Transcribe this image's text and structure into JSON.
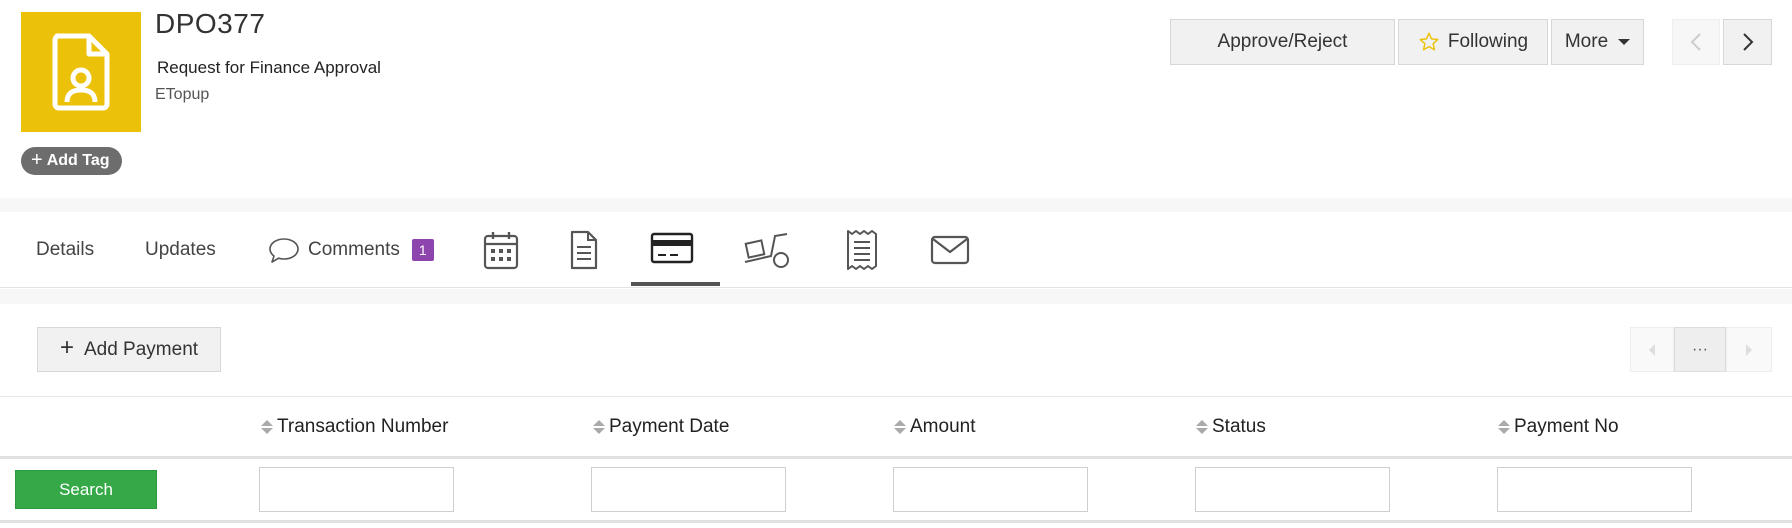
{
  "record": {
    "id": "DPO377",
    "title": "Request for Finance Approval",
    "subtitle": "ETopup",
    "avatar_icon": "document-user-icon",
    "avatar_color": "#ecc10a"
  },
  "tag": {
    "add_label": "Add Tag"
  },
  "actions": {
    "approve_label": "Approve/Reject",
    "following_label": "Following",
    "more_label": "More"
  },
  "tabs": {
    "details": "Details",
    "updates": "Updates",
    "comments": "Comments",
    "comments_count": "1",
    "icon_tabs": [
      "calendar-icon",
      "document-icon",
      "payment-card-icon",
      "delivery-icon",
      "receipt-icon",
      "mail-icon"
    ],
    "active": "payment-card-icon"
  },
  "toolbar": {
    "add_payment_label": "Add Payment",
    "pager_ellipsis": "···"
  },
  "table": {
    "columns": [
      "Transaction Number",
      "Payment Date",
      "Amount",
      "Status",
      "Payment No"
    ],
    "search_label": "Search"
  },
  "colors": {
    "search_button": "#35a947",
    "badge": "#8e44ad",
    "star": "#ecc10a"
  }
}
